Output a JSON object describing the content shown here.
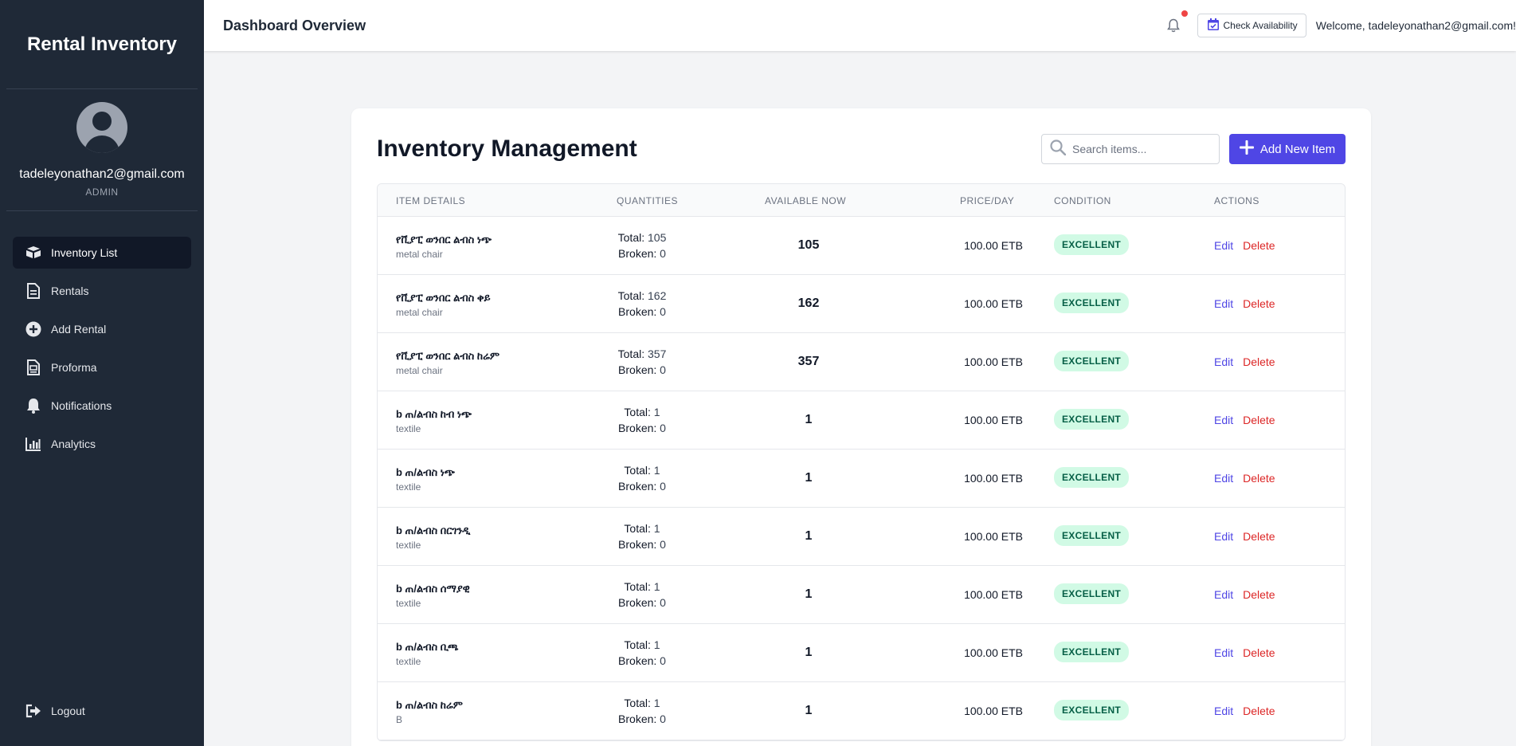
{
  "sidebar": {
    "brand": "Rental Inventory",
    "user_email": "tadeleyonathan2@gmail.com",
    "user_role": "ADMIN",
    "items": [
      {
        "label": "Inventory List",
        "icon": "boxes-icon",
        "active": true
      },
      {
        "label": "Rentals",
        "icon": "document-icon",
        "active": false
      },
      {
        "label": "Add Rental",
        "icon": "plus-circle-icon",
        "active": false
      },
      {
        "label": "Proforma",
        "icon": "file-invoice-icon",
        "active": false
      },
      {
        "label": "Notifications",
        "icon": "bell-icon",
        "active": false
      },
      {
        "label": "Analytics",
        "icon": "chart-bar-icon",
        "active": false
      }
    ],
    "logout_label": "Logout"
  },
  "header": {
    "title": "Dashboard Overview",
    "check_availability_label": "Check Availability",
    "welcome_text": "Welcome, tadeleyonathan2@gmail.com!"
  },
  "main": {
    "title": "Inventory Management",
    "search_placeholder": "Search items...",
    "add_button_label": "Add New Item",
    "columns": [
      "ITEM DETAILS",
      "QUANTITIES",
      "AVAILABLE NOW",
      "PRICE/DAY",
      "CONDITION",
      "ACTIONS"
    ],
    "total_label": "Total:",
    "broken_label": "Broken:",
    "edit_label": "Edit",
    "delete_label": "Delete",
    "rows": [
      {
        "name": "የቪያፒ ወንበር ልብስ ነጭ",
        "category": "metal chair",
        "total": "105",
        "broken": "0",
        "available": "105",
        "price": "100.00 ETB",
        "condition": "EXCELLENT"
      },
      {
        "name": "የቪያፒ ወንበር ልብስ ቀይ",
        "category": "metal chair",
        "total": "162",
        "broken": "0",
        "available": "162",
        "price": "100.00 ETB",
        "condition": "EXCELLENT"
      },
      {
        "name": "የቪያፒ ወንበር ልብስ ከሬም",
        "category": "metal chair",
        "total": "357",
        "broken": "0",
        "available": "357",
        "price": "100.00 ETB",
        "condition": "EXCELLENT"
      },
      {
        "name": "b ጠ/ልብስ ከብ ነጭ",
        "category": "textile",
        "total": "1",
        "broken": "0",
        "available": "1",
        "price": "100.00 ETB",
        "condition": "EXCELLENT"
      },
      {
        "name": "b ጠ/ልብስ ነጭ",
        "category": "textile",
        "total": "1",
        "broken": "0",
        "available": "1",
        "price": "100.00 ETB",
        "condition": "EXCELLENT"
      },
      {
        "name": "b ጠ/ልብስ በርገንዲ",
        "category": "textile",
        "total": "1",
        "broken": "0",
        "available": "1",
        "price": "100.00 ETB",
        "condition": "EXCELLENT"
      },
      {
        "name": "b ጠ/ልብስ ሰማያዊ",
        "category": "textile",
        "total": "1",
        "broken": "0",
        "available": "1",
        "price": "100.00 ETB",
        "condition": "EXCELLENT"
      },
      {
        "name": "b ጠ/ልብስ ቢጫ",
        "category": "textile",
        "total": "1",
        "broken": "0",
        "available": "1",
        "price": "100.00 ETB",
        "condition": "EXCELLENT"
      },
      {
        "name": "b ጠ/ልብስ ከሬም",
        "category": "B",
        "total": "1",
        "broken": "0",
        "available": "1",
        "price": "100.00 ETB",
        "condition": "EXCELLENT"
      }
    ]
  },
  "colors": {
    "sidebar_bg": "#1f2937",
    "accent": "#4f46e5",
    "danger": "#dc2626",
    "badge_bg": "#d1fae5",
    "badge_text": "#065f46"
  }
}
